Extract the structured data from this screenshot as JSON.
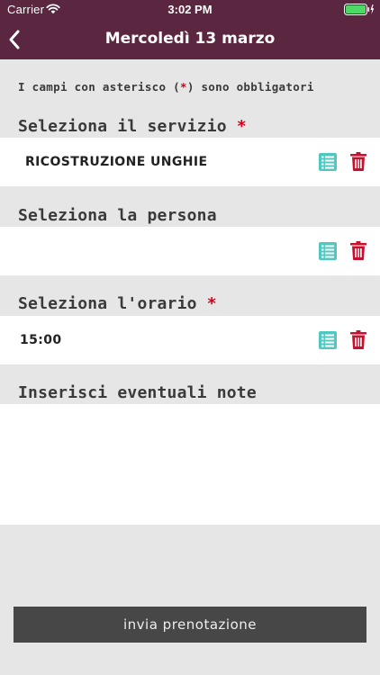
{
  "status_bar": {
    "carrier": "Carrier",
    "time": "3:02 PM"
  },
  "nav": {
    "back_icon": "chevron-left-icon",
    "title": "Mercoledì 13 marzo"
  },
  "notice": {
    "before": "I campi con asterisco (",
    "asterisk": "*",
    "after": ") sono obbligatori"
  },
  "service": {
    "label": "Seleziona il servizio",
    "required_mark": "*",
    "value": "RICOSTRUZIONE UNGHIE"
  },
  "person": {
    "label": "Seleziona la persona",
    "value": ""
  },
  "time_slot": {
    "label": "Seleziona l'orario",
    "required_mark": "*",
    "value": "15:00"
  },
  "notes": {
    "label": "Inserisci eventuali note",
    "value": ""
  },
  "submit": {
    "label": "invia prenotazione"
  },
  "colors": {
    "header": "#5b2640",
    "background": "#e6e6e6",
    "field": "#ffffff",
    "required": "#d0021b",
    "list_icon": "#50c8c0",
    "trash_icon": "#c8102e",
    "button": "#474747"
  },
  "icons": {
    "list": "list-icon",
    "delete": "trash-icon",
    "wifi": "wifi-icon",
    "battery": "battery-icon"
  }
}
